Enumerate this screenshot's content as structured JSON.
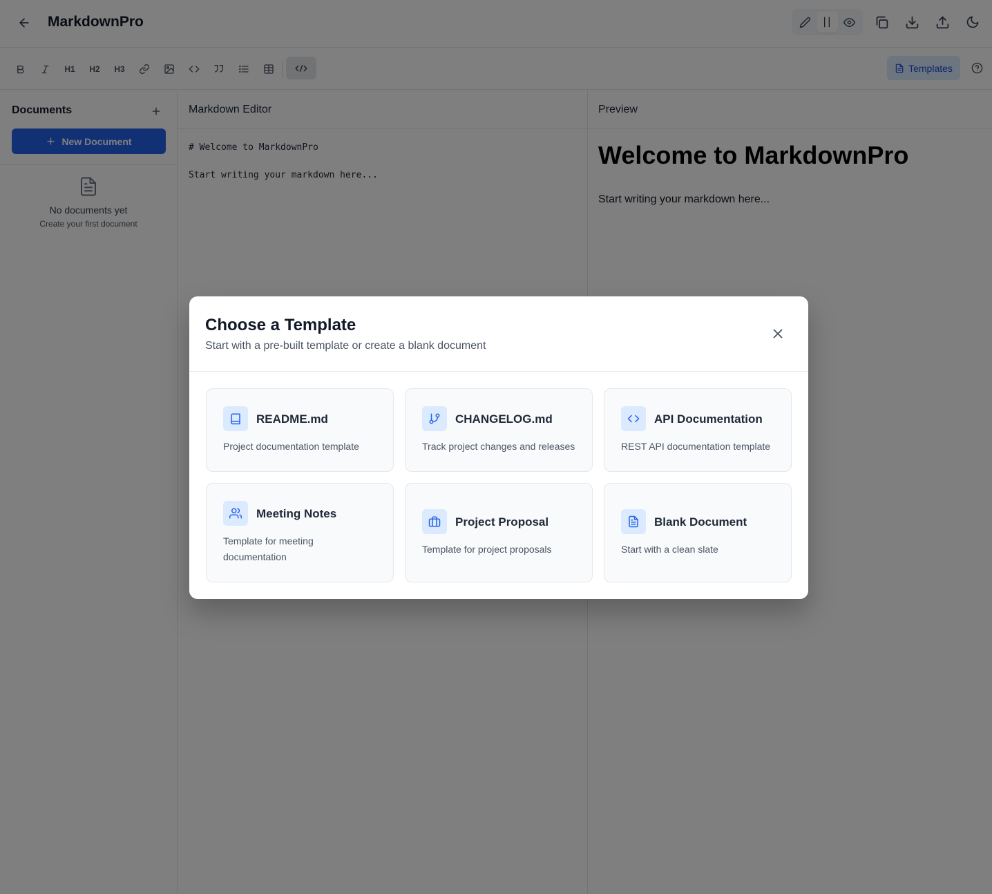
{
  "header": {
    "title": "MarkdownPro",
    "view_modes": [
      "edit",
      "split",
      "preview"
    ],
    "active_view": "split"
  },
  "toolbar": {
    "h1": "H1",
    "h2": "H2",
    "h3": "H3",
    "templates_label": "Templates"
  },
  "sidebar": {
    "title": "Documents",
    "new_document_label": "New Document",
    "empty_title": "No documents yet",
    "empty_subtitle": "Create your first document"
  },
  "editor": {
    "title": "Markdown Editor",
    "content": "# Welcome to MarkdownPro\n\nStart writing your markdown here..."
  },
  "preview": {
    "title": "Preview",
    "heading": "Welcome to MarkdownPro",
    "paragraph": "Start writing your markdown here..."
  },
  "modal": {
    "title": "Choose a Template",
    "subtitle": "Start with a pre-built template or create a blank document",
    "templates": [
      {
        "name": "README.md",
        "description": "Project documentation template",
        "icon": "book-icon"
      },
      {
        "name": "CHANGELOG.md",
        "description": "Track project changes and releases",
        "icon": "git-branch-icon"
      },
      {
        "name": "API Documentation",
        "description": "REST API documentation template",
        "icon": "code-icon"
      },
      {
        "name": "Meeting Notes",
        "description": "Template for meeting documentation",
        "icon": "users-icon"
      },
      {
        "name": "Project Proposal",
        "description": "Template for project proposals",
        "icon": "briefcase-icon"
      },
      {
        "name": "Blank Document",
        "description": "Start with a clean slate",
        "icon": "file-text-icon"
      }
    ]
  },
  "colors": {
    "accent": "#2563eb",
    "accent_light": "#dbeafe"
  }
}
